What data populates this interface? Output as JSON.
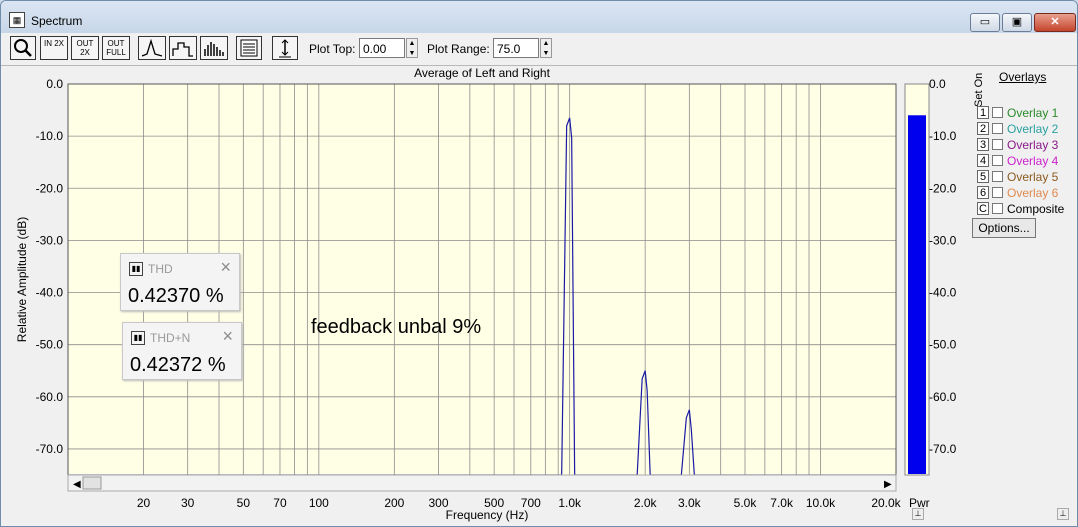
{
  "window": {
    "title": "Spectrum",
    "min_label": "▭",
    "max_label": "▣",
    "close_label": "✕"
  },
  "toolbar": {
    "zoom_in": "IN 2X",
    "zoom_out": "OUT 2X",
    "zoom_full": "OUT FULL",
    "plot_top_label": "Plot Top:",
    "plot_top_value": "0.00",
    "plot_range_label": "Plot Range:",
    "plot_range_value": "75.0"
  },
  "chart": {
    "title": "Average of Left and Right",
    "xlabel": "Frequency (Hz)",
    "ylabel": "Relative Amplitude (dB)",
    "power_label": "Pwr",
    "ylabels": [
      "0.0",
      "-10.0",
      "-20.0",
      "-30.0",
      "-40.0",
      "-50.0",
      "-60.0",
      "-70.0"
    ],
    "xlabels": [
      "20",
      "30",
      "50",
      "70",
      "100",
      "200",
      "300",
      "500",
      "700",
      "1.0k",
      "2.0k",
      "3.0k",
      "5.0k",
      "7.0k",
      "10.0k",
      "20.0k"
    ],
    "background": "#ffffe6",
    "trace_color": "#1a1aa6",
    "power_color": "#0000ee"
  },
  "chart_data": {
    "type": "line",
    "title": "Average of Left and Right",
    "xlabel": "Frequency (Hz)",
    "ylabel": "Relative Amplitude (dB)",
    "xscale": "log",
    "xlim": [
      10,
      20000
    ],
    "ylim": [
      -75,
      0
    ],
    "grid": true,
    "peaks": [
      {
        "x": 1000,
        "y": -6.5
      },
      {
        "x": 2000,
        "y": -55.0
      },
      {
        "x": 3000,
        "y": -62.5
      }
    ],
    "noise_floor": -75,
    "power_level": -6
  },
  "readouts": [
    {
      "label": "THD",
      "value": "0.42370 %"
    },
    {
      "label": "THD+N",
      "value": "0.42372 %"
    }
  ],
  "annotation": "feedback unbal 9%",
  "overlays": {
    "title": "Overlays",
    "set_on": "Set On",
    "items": [
      {
        "num": "1",
        "label": "Overlay 1",
        "color": "#2a8a2a"
      },
      {
        "num": "2",
        "label": "Overlay 2",
        "color": "#2aa0a0"
      },
      {
        "num": "3",
        "label": "Overlay 3",
        "color": "#8a1a8a"
      },
      {
        "num": "4",
        "label": "Overlay 4",
        "color": "#cc22cc"
      },
      {
        "num": "5",
        "label": "Overlay 5",
        "color": "#8a5a20"
      },
      {
        "num": "6",
        "label": "Overlay 6",
        "color": "#e08a50"
      },
      {
        "num": "C",
        "label": "Composite",
        "color": "#000000"
      }
    ],
    "options_label": "Options..."
  }
}
